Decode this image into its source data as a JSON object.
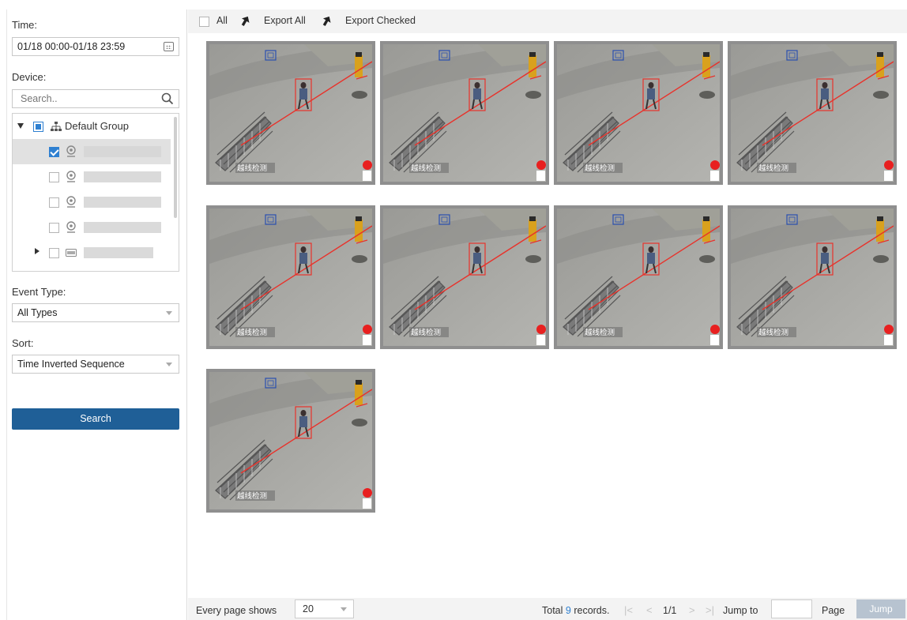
{
  "left_panel": {
    "time_label": "Time:",
    "time_value": "01/18 00:00-01/18 23:59",
    "device_label": "Device:",
    "search_placeholder": "Search..",
    "tree": {
      "group_label": "Default Group",
      "group_state": "partial",
      "items": [
        {
          "type": "camera",
          "checked": true,
          "selected": true
        },
        {
          "type": "camera",
          "checked": false,
          "selected": false
        },
        {
          "type": "camera",
          "checked": false,
          "selected": false
        },
        {
          "type": "camera",
          "checked": false,
          "selected": false
        },
        {
          "type": "nvr",
          "checked": false,
          "selected": false,
          "collapsed": true
        }
      ]
    },
    "event_type_label": "Event Type:",
    "event_type_value": "All Types",
    "sort_label": "Sort:",
    "sort_value": "Time Inverted Sequence",
    "search_button": "Search"
  },
  "toolbar": {
    "all_label": "All",
    "export_all": "Export All",
    "export_checked": "Export Checked"
  },
  "results": {
    "overlay_text": "越线检测",
    "thumbnails": [
      1,
      2,
      3,
      4,
      5,
      6,
      7,
      8,
      9
    ]
  },
  "footer": {
    "every_page_label": "Every page shows",
    "page_size": "20",
    "total_prefix": "Total",
    "total_count": "9",
    "total_suffix": "records.",
    "page_indicator": "1/1",
    "jump_to_label": "Jump to",
    "page_label": "Page",
    "jump_button": "Jump"
  },
  "colors": {
    "primary": "#1f5f97",
    "checkbox_blue": "#2f80d1",
    "detection_red": "#e8322b"
  }
}
